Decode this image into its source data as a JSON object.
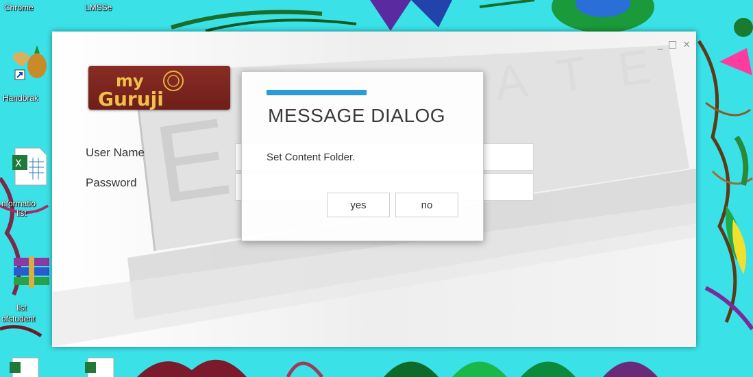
{
  "desktop": {
    "icons": [
      {
        "label": "Chrome"
      },
      {
        "label": "LMSSe"
      },
      {
        "label": "Handbrak"
      },
      {
        "label": "nformatio"
      },
      {
        "label": "list"
      },
      {
        "label": "list"
      },
      {
        "label": "ofstudent"
      }
    ]
  },
  "window": {
    "controls": {
      "minimize": "_",
      "maximize": "□",
      "close": "×"
    }
  },
  "login": {
    "username_label": "User Name",
    "password_label": "Password",
    "username_value": "",
    "password_value": ""
  },
  "dialog": {
    "title": "MESSAGE DIALOG",
    "message": "Set Content Folder.",
    "yes_label": "yes",
    "no_label": "no"
  },
  "colors": {
    "accent": "#2e9ad7",
    "logo_bg": "#7a2520"
  }
}
